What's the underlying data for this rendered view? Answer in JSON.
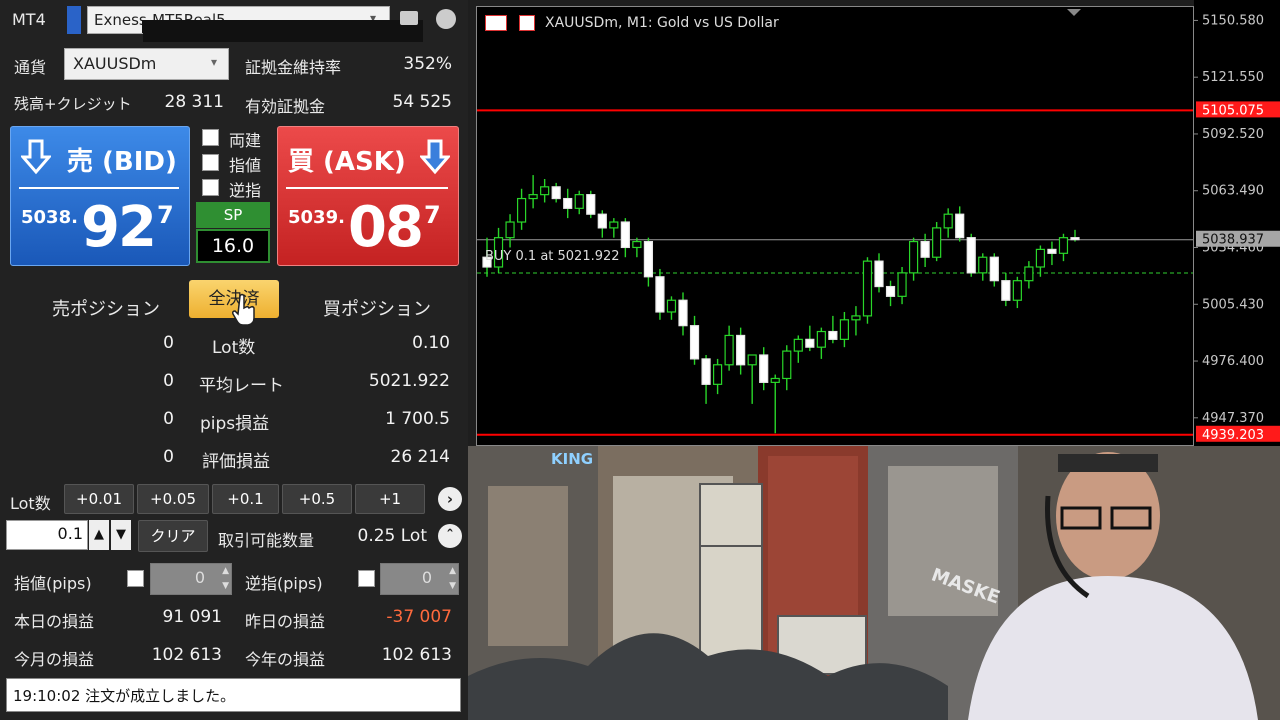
{
  "app": {
    "title": "MT4",
    "account_name": "Exness-MT5Real5"
  },
  "symbol": {
    "label": "通貨",
    "value": "XAUUSDm"
  },
  "margin": {
    "label": "証拠金維持率",
    "value": "352%"
  },
  "balance": {
    "label": "残高+クレジット",
    "value": "28 311"
  },
  "equity": {
    "label": "有効証拠金",
    "value": "54 525"
  },
  "sell": {
    "label": "売 (BID)",
    "price_main": "5038.",
    "price_big": "92",
    "price_small": "7",
    "arrow": "down-arrow-icon"
  },
  "buy": {
    "label": "買 (ASK)",
    "price_main": "5039.",
    "price_big": "08",
    "price_small": "7",
    "arrow": "down-arrow-icon"
  },
  "options": [
    "両建",
    "指値",
    "逆指"
  ],
  "spread": {
    "label": "SP",
    "value": "16.0"
  },
  "positions": {
    "sell_title": "売ポジション",
    "close_all": "全決済",
    "buy_title": "買ポジション",
    "rows": [
      {
        "sell": "0",
        "label": "Lot数",
        "buy": "0.10"
      },
      {
        "sell": "0",
        "label": "平均レート",
        "buy": "5021.922"
      },
      {
        "sell": "0",
        "label": "pips損益",
        "buy": "1 700.5"
      },
      {
        "sell": "0",
        "label": "評価損益",
        "buy": "26 214"
      }
    ]
  },
  "lot": {
    "label": "Lot数",
    "steps": [
      "+0.01",
      "+0.05",
      "+0.1",
      "+0.5",
      "+1"
    ],
    "value": "0.1",
    "clear": "クリア",
    "tradable_label": "取引可能数量",
    "tradable_value": "0.25 Lot"
  },
  "limit": {
    "label": "指値(pips)",
    "value": "0"
  },
  "stop": {
    "label": "逆指(pips)",
    "value": "0"
  },
  "pnl": {
    "today_label": "本日の損益",
    "today": "91 091",
    "yesterday_label": "昨日の損益",
    "yesterday": "-37 007",
    "month_label": "今月の損益",
    "month": "102 613",
    "year_label": "今年の損益",
    "year": "102 613"
  },
  "status": "19:10:02 注文が成立しました。",
  "colors": {
    "sell": "#1f63c4",
    "buy": "#d83434",
    "accent_close": "#f4c04a",
    "loss": "#ff6a3d"
  },
  "chart_data": {
    "type": "candlestick",
    "title": "XAUUSDm, M1:  Gold vs US Dollar",
    "position_label": "BUY 0.1 at 5021.922",
    "ylim": [
      4935,
      5160
    ],
    "y_ticks": [
      "5150.580",
      "5121.550",
      "5092.520",
      "5063.490",
      "5034.460",
      "5005.430",
      "4976.400",
      "4947.370"
    ],
    "hlines": [
      {
        "label": "5105.075",
        "value": 5105.075,
        "color": "#ff0000"
      },
      {
        "label": "4939.203",
        "value": 4939.203,
        "color": "#ff0000"
      },
      {
        "label": "5038.937",
        "value": 5038.937,
        "color": "#9a9a9a"
      }
    ],
    "entry": 5021.922,
    "candles": [
      [
        5030,
        5040,
        5020,
        5025
      ],
      [
        5025,
        5045,
        5022,
        5040
      ],
      [
        5040,
        5052,
        5035,
        5048
      ],
      [
        5048,
        5065,
        5044,
        5060
      ],
      [
        5060,
        5072,
        5055,
        5062
      ],
      [
        5062,
        5070,
        5058,
        5066
      ],
      [
        5066,
        5068,
        5058,
        5060
      ],
      [
        5060,
        5065,
        5050,
        5055
      ],
      [
        5055,
        5064,
        5052,
        5062
      ],
      [
        5062,
        5064,
        5050,
        5052
      ],
      [
        5052,
        5054,
        5040,
        5045
      ],
      [
        5045,
        5050,
        5040,
        5048
      ],
      [
        5048,
        5050,
        5030,
        5035
      ],
      [
        5035,
        5040,
        5030,
        5038
      ],
      [
        5038,
        5040,
        5015,
        5020
      ],
      [
        5020,
        5024,
        4998,
        5002
      ],
      [
        5002,
        5010,
        4998,
        5008
      ],
      [
        5008,
        5012,
        4990,
        4995
      ],
      [
        4995,
        5000,
        4975,
        4978
      ],
      [
        4978,
        4980,
        4955,
        4965
      ],
      [
        4965,
        4978,
        4960,
        4975
      ],
      [
        4975,
        4995,
        4972,
        4990
      ],
      [
        4990,
        4994,
        4970,
        4975
      ],
      [
        4975,
        4980,
        4955,
        4980
      ],
      [
        4980,
        4984,
        4962,
        4966
      ],
      [
        4966,
        4970,
        4940,
        4968
      ],
      [
        4968,
        4985,
        4962,
        4982
      ],
      [
        4982,
        4990,
        4976,
        4988
      ],
      [
        4988,
        4995,
        4982,
        4984
      ],
      [
        4984,
        4994,
        4978,
        4992
      ],
      [
        4992,
        5000,
        4986,
        4988
      ],
      [
        4988,
        5002,
        4984,
        4998
      ],
      [
        4998,
        5005,
        4990,
        5000
      ],
      [
        5000,
        5030,
        4996,
        5028
      ],
      [
        5028,
        5032,
        5012,
        5015
      ],
      [
        5015,
        5018,
        5005,
        5010
      ],
      [
        5010,
        5025,
        5006,
        5022
      ],
      [
        5022,
        5040,
        5018,
        5038
      ],
      [
        5038,
        5042,
        5025,
        5030
      ],
      [
        5030,
        5048,
        5028,
        5045
      ],
      [
        5045,
        5055,
        5040,
        5052
      ],
      [
        5052,
        5056,
        5038,
        5040
      ],
      [
        5040,
        5042,
        5020,
        5022
      ],
      [
        5022,
        5032,
        5018,
        5030
      ],
      [
        5030,
        5032,
        5015,
        5018
      ],
      [
        5018,
        5022,
        5005,
        5008
      ],
      [
        5008,
        5020,
        5004,
        5018
      ],
      [
        5018,
        5028,
        5014,
        5025
      ],
      [
        5025,
        5036,
        5020,
        5034
      ],
      [
        5034,
        5038,
        5026,
        5032
      ],
      [
        5032,
        5042,
        5028,
        5040
      ],
      [
        5040,
        5044,
        5038,
        5039
      ]
    ]
  },
  "webcam": {
    "sign_text": "KING",
    "graffiti_text": "MASKE"
  }
}
